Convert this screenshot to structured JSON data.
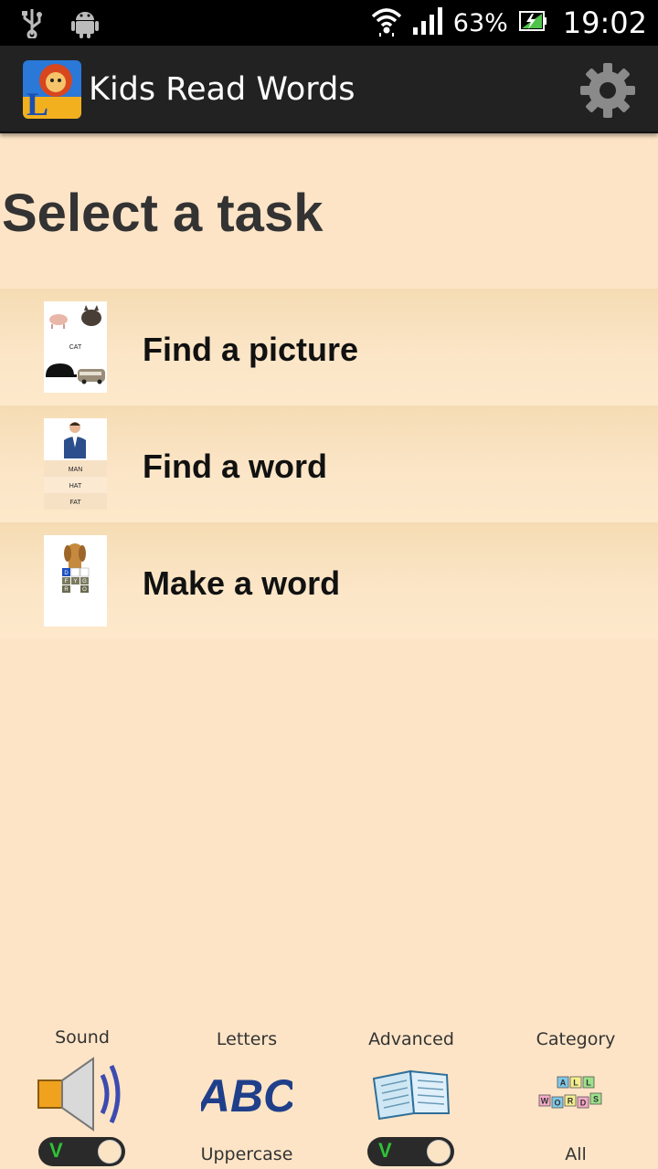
{
  "status_bar": {
    "battery_percent": "63%",
    "time": "19:02",
    "icons": [
      "usb-icon",
      "android-debug-icon",
      "wifi-icon",
      "signal-icon",
      "battery-charging-icon"
    ]
  },
  "action_bar": {
    "title": "Kids Read Words",
    "app_icon": "lion-logo-icon",
    "settings_icon": "gear-icon"
  },
  "heading": "Select a task",
  "tasks": [
    {
      "label": "Find a picture",
      "thumb_text": "CAT"
    },
    {
      "label": "Find a word",
      "thumb_words": [
        "MAN",
        "HAT",
        "FAT"
      ]
    },
    {
      "label": "Make a word",
      "thumb_letters": [
        "D",
        "F",
        "Y",
        "G",
        "R",
        "O"
      ]
    }
  ],
  "options": {
    "sound": {
      "caption": "Sound",
      "toggle_on": true,
      "toggle_mark": "V"
    },
    "letters": {
      "caption": "Letters",
      "value": "Uppercase",
      "icon_text": "ABC"
    },
    "advanced": {
      "caption": "Advanced",
      "toggle_on": true,
      "toggle_mark": "V"
    },
    "category": {
      "caption": "Category",
      "value": "All",
      "icon_letters": [
        "A",
        "L",
        "L",
        "W",
        "O",
        "R",
        "D",
        "S"
      ]
    }
  },
  "colors": {
    "background": "#fde4c6",
    "action_bar": "#222222",
    "toggle_check": "#2fc236"
  }
}
